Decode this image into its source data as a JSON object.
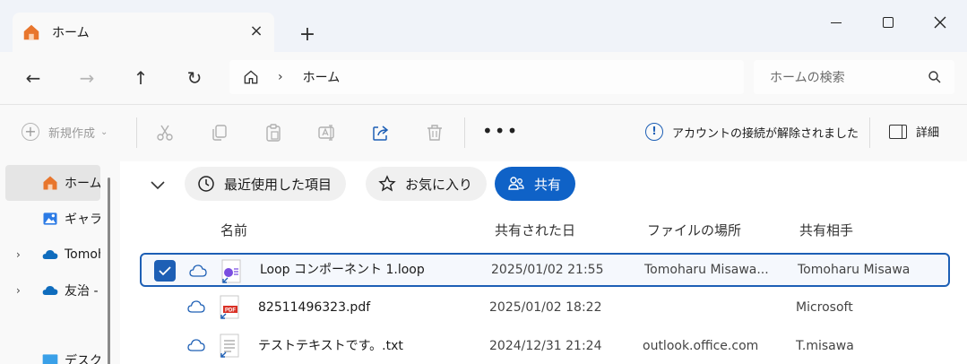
{
  "window": {
    "tab_title": "ホーム",
    "tab_close": "×",
    "new_tab": "+"
  },
  "nav": {
    "back": "←",
    "forward": "→",
    "up": "↑",
    "refresh": "↻",
    "address_chevron": "›",
    "address_location": "ホーム",
    "search_placeholder": "ホームの検索"
  },
  "toolbar": {
    "new_label": "新規作成",
    "new_caret": "⌄",
    "more": "•••",
    "notice_text": "アカウントの接続が解除されました",
    "details_label": "詳細"
  },
  "sidebar": {
    "items": [
      {
        "label": "ホーム",
        "icon": "home-icon",
        "arrow": ""
      },
      {
        "label": "ギャラリー",
        "icon": "gallery-icon",
        "arrow": ""
      },
      {
        "label": "Tomoharu",
        "icon": "onedrive-icon",
        "arrow": "›"
      },
      {
        "label": "友治 - 個人用",
        "icon": "onedrive-icon",
        "arrow": "›"
      },
      {
        "label": "デスクトップ",
        "icon": "desktop-icon",
        "arrow": ""
      }
    ]
  },
  "filters": {
    "recent": "最近使用した項目",
    "favorites": "お気に入り",
    "shared": "共有"
  },
  "columns": {
    "name": "名前",
    "shared_date": "共有された日",
    "location": "ファイルの場所",
    "shared_with": "共有相手"
  },
  "files": [
    {
      "name": "Loop コンポーネント 1.loop",
      "date": "2025/01/02 21:55",
      "location": "Tomoharu Misawa...",
      "shared_with": "Tomoharu Misawa",
      "type": "loop",
      "selected": true
    },
    {
      "name": "82511496323.pdf",
      "date": "2025/01/02 18:22",
      "location": "",
      "shared_with": "Microsoft",
      "type": "pdf",
      "selected": false
    },
    {
      "name": "テストテキストです。.txt",
      "date": "2024/12/31 21:24",
      "location": "outlook.office.com",
      "shared_with": "T.misawa",
      "type": "txt",
      "selected": false
    }
  ],
  "colors": {
    "accent": "#1d5fb5",
    "pill_active": "#0f62c7",
    "home_orange": "#e8762d",
    "onedrive_blue": "#0f6cbd"
  }
}
